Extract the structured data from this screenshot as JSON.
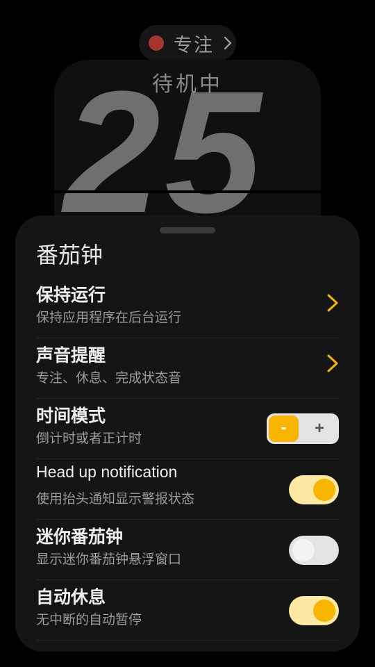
{
  "mode_pill": {
    "label": "专注",
    "dot_color": "#a7352d",
    "chevron_icon": "chevron-right-icon"
  },
  "timer": {
    "status": "待机中",
    "minutes": "25"
  },
  "sheet": {
    "title": "番茄钟",
    "accent": "#f7b500",
    "rows": [
      {
        "title": "保持运行",
        "subtitle": "保持应用程序在后台运行",
        "control": "chevron-right-icon"
      },
      {
        "title": "声音提醒",
        "subtitle": "专注、休息、完成状态音",
        "control": "chevron-right-icon"
      },
      {
        "title": "时间模式",
        "subtitle": "倒计时或者正计时",
        "control": "stepper",
        "minus": "-",
        "plus": "+"
      },
      {
        "title": "Head up notification",
        "subtitle": "使用抬头通知显示警报状态",
        "control": "toggle",
        "on": true
      },
      {
        "title": "迷你番茄钟",
        "subtitle": "显示迷你番茄钟悬浮窗口",
        "control": "toggle",
        "on": false
      },
      {
        "title": "自动休息",
        "subtitle": "无中断的自动暂停",
        "control": "toggle",
        "on": true
      }
    ]
  }
}
